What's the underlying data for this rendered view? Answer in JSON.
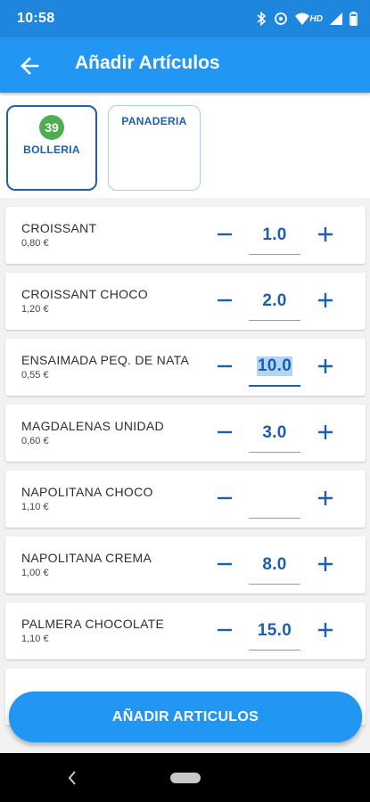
{
  "status_bar": {
    "time": "10:58",
    "network_label": "HD"
  },
  "app_bar": {
    "title": "Añadir Artículos"
  },
  "categories": [
    {
      "label": "BOLLERIA",
      "badge": "39",
      "selected": true
    },
    {
      "label": "PANADERIA",
      "selected": false
    }
  ],
  "items": [
    {
      "name": "CROISSANT",
      "price": "0,80 €",
      "qty": "1.0"
    },
    {
      "name": "CROISSANT CHOCO",
      "price": "1,20 €",
      "qty": "2.0"
    },
    {
      "name": "ENSAIMADA PEQ. DE NATA",
      "price": "0,55 €",
      "qty": "10.0",
      "focused": true
    },
    {
      "name": "MAGDALENAS UNIDAD",
      "price": "0,60 €",
      "qty": "3.0"
    },
    {
      "name": "NAPOLITANA CHOCO",
      "price": "1,10 €",
      "qty": ""
    },
    {
      "name": "NAPOLITANA CREMA",
      "price": "1,00 €",
      "qty": "8.0"
    },
    {
      "name": "PALMERA CHOCOLATE",
      "price": "1,10 €",
      "qty": "15.0"
    }
  ],
  "footer": {
    "button_label": "AÑADIR ARTICULOS"
  },
  "colors": {
    "primary": "#2196f3",
    "status_bar": "#1f86dd",
    "accent_text": "#1c5fb0",
    "badge": "#4caf50"
  }
}
